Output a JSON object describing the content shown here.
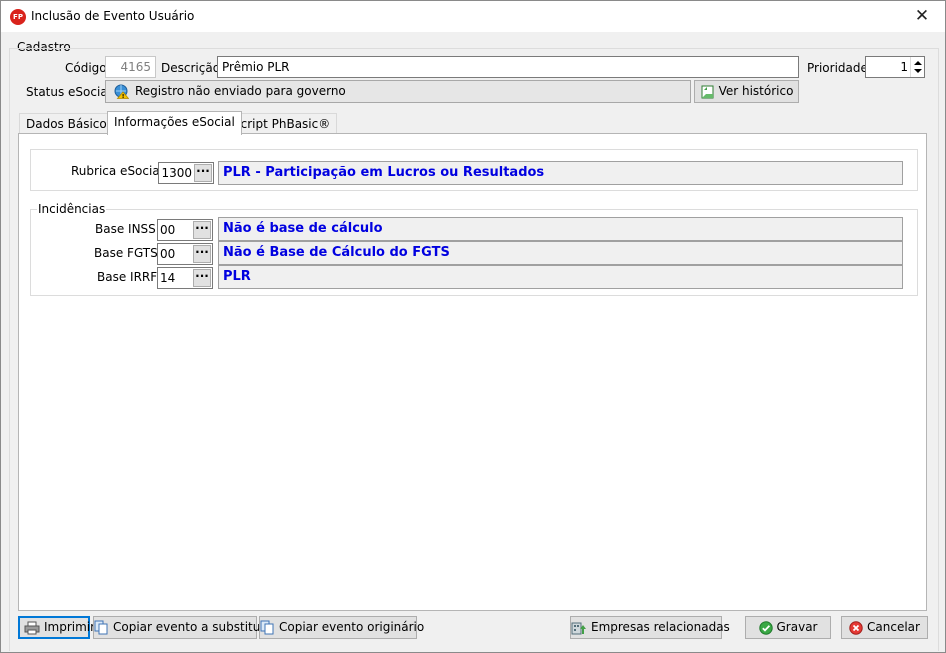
{
  "window": {
    "app_icon_text": "FP",
    "title": "Inclusão de Evento Usuário",
    "close_glyph": "✕"
  },
  "cadastro": {
    "group_label": "Cadastro",
    "codigo_label": "Código",
    "codigo_value": "4165",
    "descricao_label": "Descrição",
    "descricao_value": "Prêmio PLR",
    "prioridade_label": "Prioridade",
    "prioridade_value": "1",
    "status_label": "Status eSocial",
    "status_value": "Registro não enviado para governo",
    "historico_button": "Ver histórico"
  },
  "tabs": [
    {
      "label": "Dados Básicos",
      "active": false
    },
    {
      "label": "Informações eSocial",
      "active": true
    },
    {
      "label": "Script PhBasic®",
      "active": false
    }
  ],
  "esocial": {
    "rubrica_label": "Rubrica eSocial",
    "rubrica_code": "1300",
    "rubrica_desc": "PLR - Participação em Lucros ou Resultados",
    "incidencias_label": "Incidências",
    "rows": [
      {
        "label": "Base INSS:",
        "code": "00",
        "desc": "Não é base de cálculo"
      },
      {
        "label": "Base FGTS:",
        "code": "00",
        "desc": "Não é Base de Cálculo do FGTS"
      },
      {
        "label": "Base IRRF:",
        "code": "14",
        "desc": "PLR"
      }
    ]
  },
  "footer": {
    "imprimir": "Imprimir",
    "copiar_substituir": "Copiar evento a substituir",
    "copiar_originario": "Copiar evento originário",
    "empresas": "Empresas relacionadas",
    "gravar": "Gravar",
    "cancelar": "Cancelar"
  },
  "icons": {
    "status": "warning-globe-icon",
    "historico": "history-document-icon",
    "imprimir": "printer-icon",
    "copiar": "copy-icon",
    "empresas": "companies-icon",
    "gravar": "check-circle-icon",
    "cancelar": "cancel-circle-icon"
  },
  "colors": {
    "description_text": "#0000e0",
    "focus_border": "#0078d7",
    "app_icon": "#d9231c"
  }
}
